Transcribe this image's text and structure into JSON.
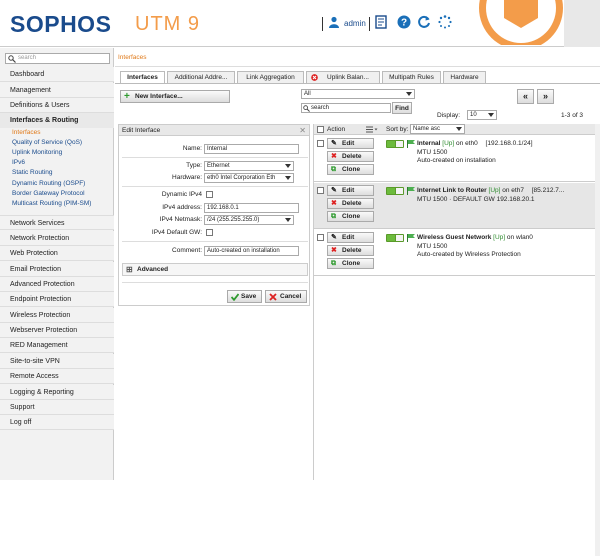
{
  "header": {
    "logo": "SOPHOS",
    "product": "UTM 9",
    "user": "admin",
    "brand_color": "#1a4b8c",
    "accent_color": "#f39c4a"
  },
  "sidebar": {
    "search_placeholder": "search",
    "items": [
      {
        "label": "Dashboard"
      },
      {
        "label": "Management"
      },
      {
        "label": "Definitions & Users"
      },
      {
        "label": "Interfaces & Routing"
      },
      {
        "label": "Network Services"
      },
      {
        "label": "Network Protection"
      },
      {
        "label": "Web Protection"
      },
      {
        "label": "Email Protection"
      },
      {
        "label": "Advanced Protection"
      },
      {
        "label": "Endpoint Protection"
      },
      {
        "label": "Wireless Protection"
      },
      {
        "label": "Webserver Protection"
      },
      {
        "label": "RED Management"
      },
      {
        "label": "Site-to-site VPN"
      },
      {
        "label": "Remote Access"
      },
      {
        "label": "Logging & Reporting"
      },
      {
        "label": "Support"
      },
      {
        "label": "Log off"
      }
    ],
    "subitems": [
      {
        "label": "Interfaces"
      },
      {
        "label": "Quality of Service (QoS)"
      },
      {
        "label": "Uplink Monitoring"
      },
      {
        "label": "IPv6"
      },
      {
        "label": "Static Routing"
      },
      {
        "label": "Dynamic Routing (OSPF)"
      },
      {
        "label": "Border Gateway Protocol"
      },
      {
        "label": "Multicast Routing (PIM-SM)"
      }
    ]
  },
  "breadcrumb": "Interfaces",
  "tabs": [
    {
      "label": "Interfaces"
    },
    {
      "label": "Additional Addre..."
    },
    {
      "label": "Link Aggregation"
    },
    {
      "label": "Uplink Balan..."
    },
    {
      "label": "Multipath Rules"
    },
    {
      "label": "Hardware"
    }
  ],
  "toolbar": {
    "new_label": "New Interface...",
    "filter_value": "All",
    "search_placeholder": "search",
    "find_label": "Find",
    "display_label": "Display:",
    "display_value": "10",
    "range": "1-3 of 3",
    "prev": "«",
    "next": "»"
  },
  "edit_panel": {
    "title": "Edit Interface",
    "close": "✕",
    "name_label": "Name:",
    "name_value": "Internal",
    "type_label": "Type:",
    "type_value": "Ethernet",
    "hardware_label": "Hardware:",
    "hardware_value": "eth0 Intel Corporation Eth",
    "dynamic_label": "Dynamic IPv4",
    "ipv4_label": "IPv4 address:",
    "ipv4_value": "192.168.0.1",
    "netmask_label": "IPv4 Netmask:",
    "netmask_value": "/24 (255.255.255.0)",
    "defgw_label": "IPv4 Default GW:",
    "comment_label": "Comment:",
    "comment_value": "Auto-created on installation",
    "advanced_label": "Advanced",
    "save_label": "Save",
    "cancel_label": "Cancel"
  },
  "list": {
    "action_header": "Action",
    "sortby_label": "Sort by:",
    "sortby_value": "Name asc",
    "edit_label": "Edit",
    "delete_label": "Delete",
    "clone_label": "Clone",
    "rows": [
      {
        "name": "Internal",
        "status": "[Up]",
        "iface": "on eth0",
        "addr": "[192.168.0.1/24]",
        "line2": "MTU 1500",
        "line3": "Auto-created on installation"
      },
      {
        "name": "Internet Link to Router",
        "status": "[Up]",
        "iface": "on eth7",
        "addr": "[85.212.7...",
        "line2": "MTU 1500 · DEFAULT GW 192.168.20.1",
        "line3": ""
      },
      {
        "name": "Wireless Guest Network",
        "status": "[Up]",
        "iface": "on wlan0",
        "addr": "",
        "line2": "MTU 1500",
        "line3": "Auto-created by Wireless Protection"
      }
    ]
  }
}
